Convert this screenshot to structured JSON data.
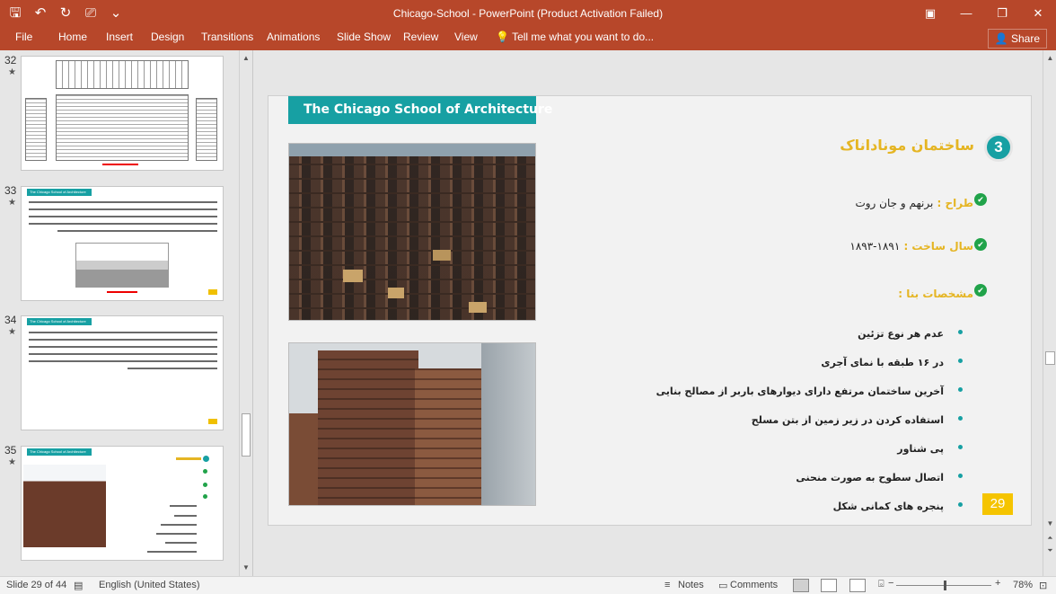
{
  "app": {
    "title": "Chicago-School - PowerPoint (Product Activation Failed)",
    "qat_icons": [
      "save-icon",
      "undo-icon",
      "redo-icon",
      "present-icon",
      "customize-icon"
    ],
    "window_controls": [
      "ribbon-display-icon",
      "minimize-icon",
      "restore-icon",
      "close-icon"
    ]
  },
  "ribbon": {
    "tabs": [
      "File",
      "Home",
      "Insert",
      "Design",
      "Transitions",
      "Animations",
      "Slide Show",
      "Review",
      "View"
    ],
    "tell_me": "Tell me what you want to do...",
    "share": "Share"
  },
  "thumbnails": [
    {
      "number": "32",
      "header": "",
      "star": "★"
    },
    {
      "number": "33",
      "header": "The Chicago School of Architecture",
      "star": "★"
    },
    {
      "number": "34",
      "header": "The Chicago School of Architecture",
      "star": "★"
    },
    {
      "number": "35",
      "header": "The Chicago School of Architecture",
      "star": "★"
    }
  ],
  "slide": {
    "header": "The Chicago School of Architecture",
    "number_badge": "3",
    "building_title": "ساختمان موناداناک",
    "info": [
      {
        "label": "طراح : ",
        "value": "برنهم و جان روت"
      },
      {
        "label": "سال ساخت : ",
        "value": "۱۸۹۱-۱۸۹۳"
      },
      {
        "label": "مشخصات بنا : ",
        "value": ""
      }
    ],
    "bullets": [
      "عدم هر نوع تزئین",
      "در ۱۶ طبقه با نمای آجری",
      "آخرین ساختمان مرتفع دارای دیوارهای باربر از مصالح بنایی",
      "استفاده کردن در زیر زمین از بتن مسلح",
      "پی شناور",
      "اتصال سطوح به صورت منحنی",
      "پنجره های کمانی شکل"
    ],
    "page_number": "29",
    "accent": "#17a0a3",
    "title_color": "#e5b523"
  },
  "status": {
    "slide_info": "Slide 29 of 44",
    "language": "English (United States)",
    "notes": "Notes",
    "comments": "Comments",
    "zoom": "78%"
  }
}
